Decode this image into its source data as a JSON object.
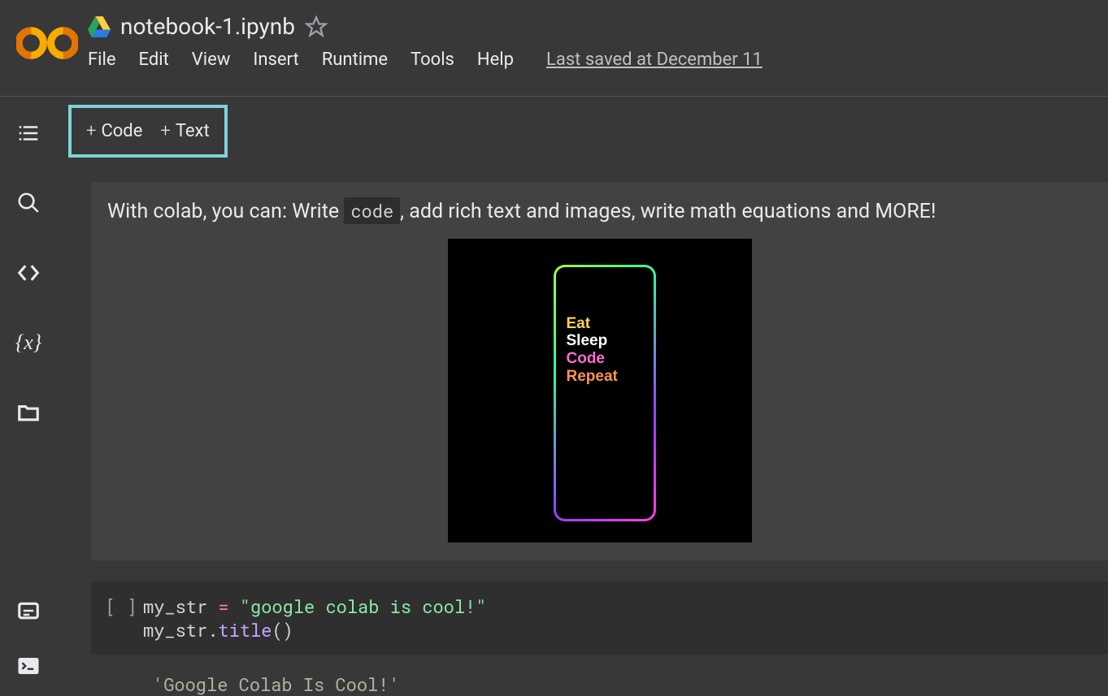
{
  "header": {
    "title": "notebook-1.ipynb",
    "menu": [
      "File",
      "Edit",
      "View",
      "Insert",
      "Runtime",
      "Tools",
      "Help"
    ],
    "saved": "Last saved at December 11"
  },
  "toolbar": {
    "code": "Code",
    "text": "Text"
  },
  "text_cell": {
    "pre": "With colab, you can: Write ",
    "code_word": "code",
    "post": ", add rich text and images, write math equations and MORE!",
    "phone": {
      "l1": "Eat",
      "l2": "Sleep",
      "l3": "Code",
      "l4": "Repeat"
    }
  },
  "code_cell": {
    "prompt": "[ ]",
    "line1_a": "my_str ",
    "line1_b": "=",
    "line1_c": " ",
    "line1_d": "\"google colab is cool!\"",
    "line2_a": "my_str.",
    "line2_b": "title",
    "line2_c": "()"
  },
  "output": "'Google Colab Is Cool!'"
}
